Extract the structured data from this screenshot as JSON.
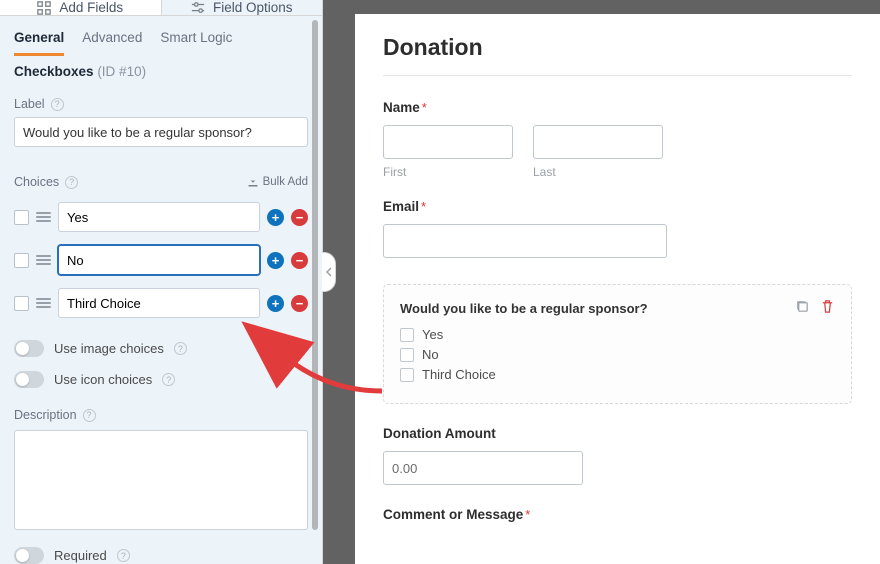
{
  "panel": {
    "tabs_top": {
      "add_fields": "Add Fields",
      "field_options": "Field Options"
    },
    "tabs_sub": {
      "general": "General",
      "advanced": "Advanced",
      "smart_logic": "Smart Logic"
    },
    "field_type": "Checkboxes",
    "field_id_label": "(ID #10)",
    "label_label": "Label",
    "label_value": "Would you like to be a regular sponsor?",
    "choices_label": "Choices",
    "bulk_add": "Bulk Add",
    "choices": [
      {
        "value": "Yes",
        "focused": false
      },
      {
        "value": "No",
        "focused": true
      },
      {
        "value": "Third Choice",
        "focused": false
      }
    ],
    "use_image": "Use image choices",
    "use_icon": "Use icon choices",
    "description_label": "Description",
    "required_label": "Required"
  },
  "preview": {
    "title": "Donation",
    "name_label": "Name",
    "first_sub": "First",
    "last_sub": "Last",
    "email_label": "Email",
    "checkbox_title": "Would you like to be a regular sponsor?",
    "checkbox_opts": [
      "Yes",
      "No",
      "Third Choice"
    ],
    "amount_label": "Donation Amount",
    "amount_value": "0.00",
    "comment_label": "Comment or Message"
  }
}
